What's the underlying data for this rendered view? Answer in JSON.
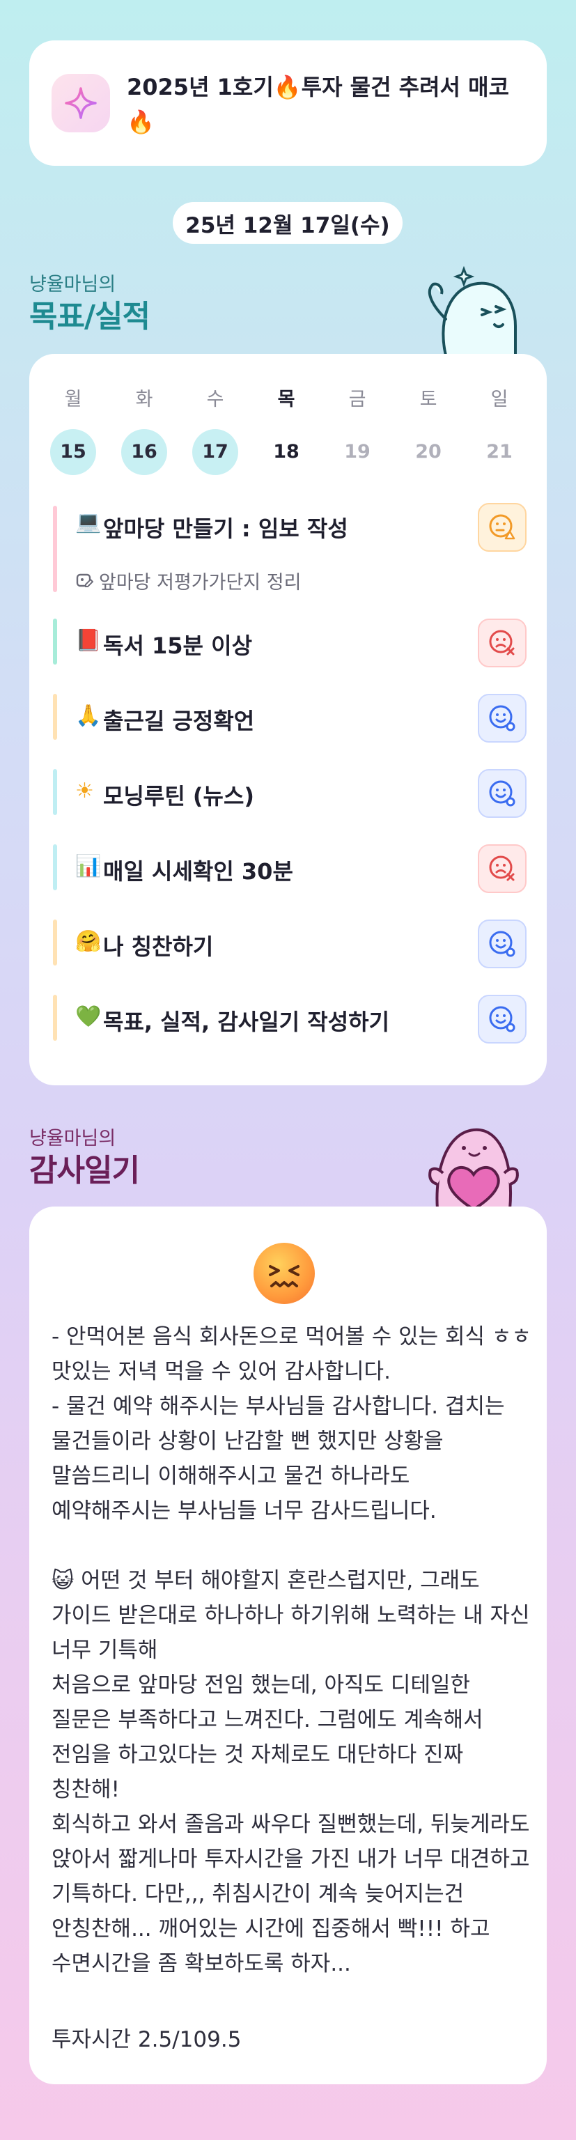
{
  "header": {
    "title": "2025년 1호기🔥투자 물건 추려서 매코🔥",
    "icon": "sparkle-icon"
  },
  "date": "25년 12월 17일(수)",
  "goals_section": {
    "subtitle": "냥율마님의",
    "title": "목표/실적",
    "mascot": "ghost-mascot"
  },
  "week": [
    {
      "label": "월",
      "day": "15",
      "state": "done"
    },
    {
      "label": "화",
      "day": "16",
      "state": "done"
    },
    {
      "label": "수",
      "day": "17",
      "state": "done"
    },
    {
      "label": "목",
      "day": "18",
      "state": "today"
    },
    {
      "label": "금",
      "day": "19",
      "state": "future"
    },
    {
      "label": "토",
      "day": "20",
      "state": "future"
    },
    {
      "label": "일",
      "day": "21",
      "state": "future"
    }
  ],
  "goals": [
    {
      "icon": "💻",
      "text": "앞마당 만들기 : 임보 작성",
      "sub": "앞마당 저평가가단지 정리",
      "status": "partial",
      "bar": "#ffc9d6"
    },
    {
      "icon": "📕",
      "text": "독서 15분 이상",
      "status": "fail",
      "bar": "#a7ecd9"
    },
    {
      "icon": "🙏",
      "text": "출근길 긍정확언",
      "status": "done",
      "bar": "#ffe2b4"
    },
    {
      "icon": "☀",
      "text": "모닝루틴 (뉴스)",
      "status": "done",
      "bar": "#bfeef3"
    },
    {
      "icon": "📊",
      "text": "매일 시세확인 30분",
      "status": "fail",
      "bar": "#bfeef3"
    },
    {
      "icon": "🤗",
      "text": "나 칭찬하기",
      "status": "done",
      "bar": "#ffe2b4"
    },
    {
      "icon": "💚",
      "text": "목표, 실적, 감사일기 작성하기",
      "status": "done",
      "bar": "#ffe2b4"
    }
  ],
  "diary_section": {
    "subtitle": "냥율마님의",
    "title": "감사일기",
    "mascot": "heart-mascot"
  },
  "diary": {
    "emoji": "confounded-face-icon",
    "body": "- 안먹어본 음식 회사돈으로 먹어볼 수 있는 회식 ㅎㅎ 맛있는 저녁 먹을 수 있어 감사합니다.\n- 물건 예약 해주시는 부사님들 감사합니다. 겹치는 물건들이라 상황이 난감할 뻔 했지만 상황을 말씀드리니 이해해주시고 물건 하나라도 예약해주시는 부사님들 너무 감사드립니다.\n\n😺 어떤 것 부터 해야할지 혼란스럽지만, 그래도 가이드 받은대로 하나하나 하기위해 노력하는 내 자신 너무 기특해\n처음으로 앞마당 전임 했는데, 아직도 디테일한 질문은 부족하다고 느껴진다. 그럼에도 계속해서 전임을 하고있다는 것 자체로도 대단하다 진짜 칭찬해!\n회식하고 와서 졸음과 싸우다 질뻔했는데, 뒤늦게라도 앉아서 짧게나마 투자시간을 가진 내가 너무 대견하고 기특하다. 다만,,, 취침시간이 계속 늦어지는건 안칭찬해... 깨어있는 시간에 집중해서 빡!!! 하고 수면시간을 좀 확보하도록 하자...",
    "footer": "투자시간 2.5/109.5"
  }
}
